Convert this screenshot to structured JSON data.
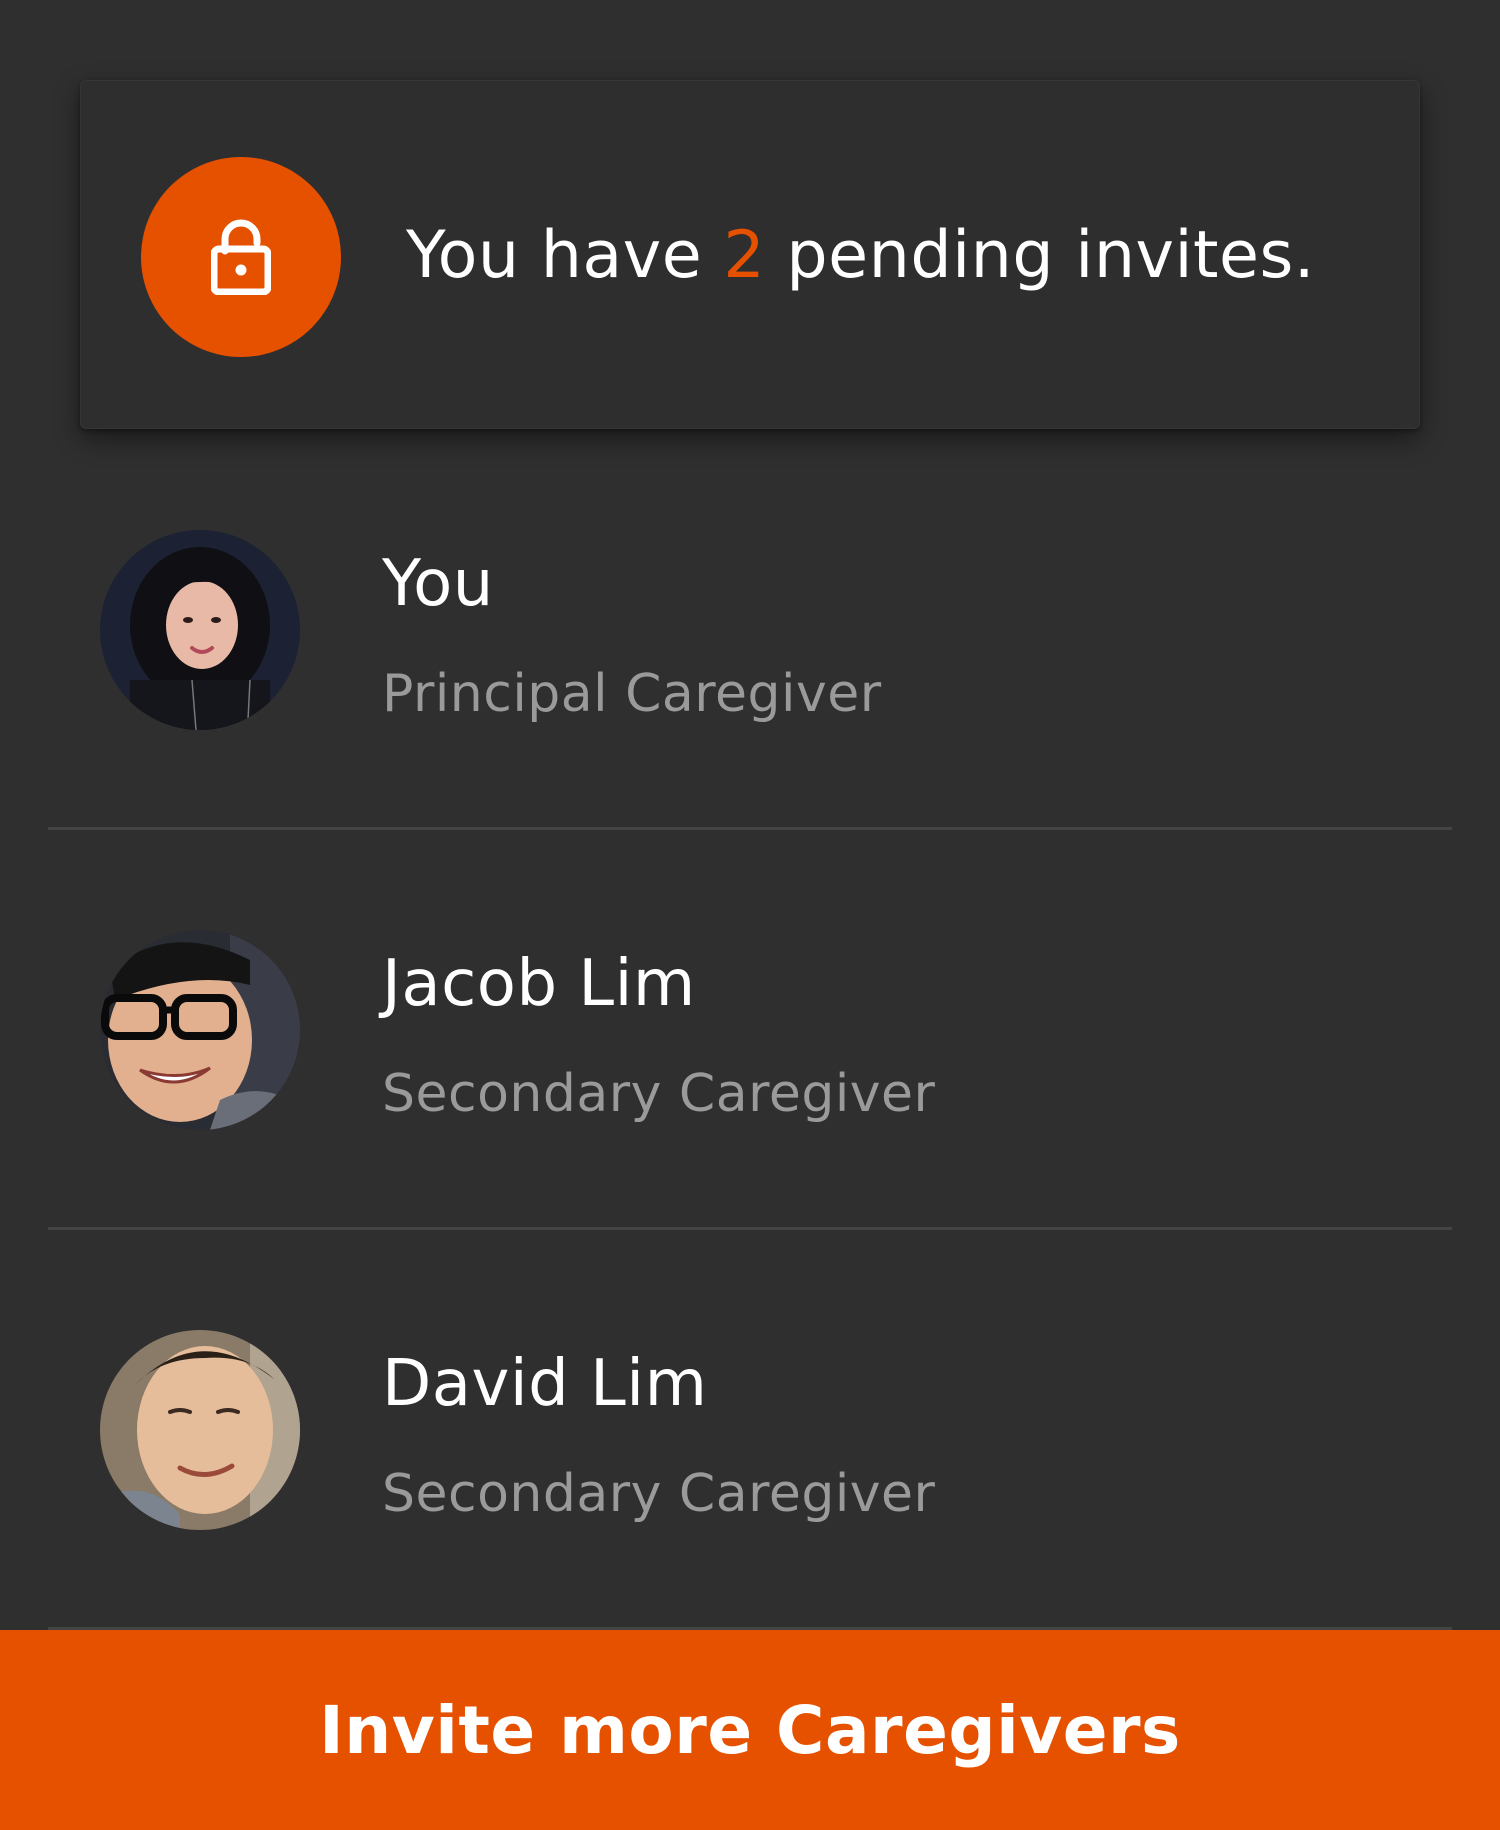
{
  "invite_card": {
    "text_before": "You have ",
    "count": "2",
    "text_after": " pending invites.",
    "icon": "lock-icon",
    "accent_color": "#e65100"
  },
  "caregivers": [
    {
      "name": "You",
      "role": "Principal Caregiver",
      "avatar": "avatar-woman"
    },
    {
      "name": "Jacob Lim",
      "role": "Secondary Caregiver",
      "avatar": "avatar-man-glasses"
    },
    {
      "name": "David Lim",
      "role": "Secondary Caregiver",
      "avatar": "avatar-man-smiling"
    }
  ],
  "invite_button": {
    "label": "Invite more Caregivers"
  },
  "colors": {
    "background": "#2f2f2f",
    "accent": "#e65100",
    "primary_text": "#ffffff",
    "secondary_text": "#9a9a9a",
    "divider": "#444444"
  }
}
